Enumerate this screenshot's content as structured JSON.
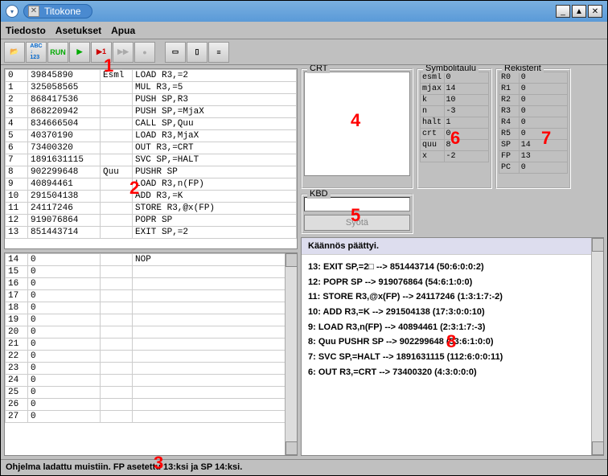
{
  "window": {
    "title": "Titokone"
  },
  "menu": {
    "file": "Tiedosto",
    "settings": "Asetukset",
    "help": "Apua"
  },
  "toolbar": {
    "open": "📂",
    "abc123": "ABC\n123",
    "run": "RUN",
    "step": "▶",
    "step1": "▶1",
    "ff": "▶▶",
    "stop": "●",
    "v1": "▭",
    "v2": "▯",
    "v3": "≡"
  },
  "marks": {
    "m1": "1",
    "m2": "2",
    "m3": "3",
    "m4": "4",
    "m5": "5",
    "m6": "6",
    "m7": "7",
    "m8": "8"
  },
  "table1": [
    [
      "0",
      "39845890",
      "Esml",
      "LOAD R3,=2"
    ],
    [
      "1",
      "325058565",
      "",
      "MUL  R3,=5"
    ],
    [
      "2",
      "868417536",
      "",
      "PUSH SP,R3"
    ],
    [
      "3",
      "868220942",
      "",
      "PUSH SP,=MjaX"
    ],
    [
      "4",
      "834666504",
      "",
      "CALL SP,Quu"
    ],
    [
      "5",
      "40370190",
      "",
      "LOAD R3,MjaX"
    ],
    [
      "6",
      "73400320",
      "",
      "OUT  R3,=CRT"
    ],
    [
      "7",
      "1891631115",
      "",
      "SVC  SP,=HALT"
    ],
    [
      "8",
      "902299648",
      "Quu",
      "PUSHR SP"
    ],
    [
      "9",
      "40894461",
      "",
      "LOAD  R3,n(FP)"
    ],
    [
      "10",
      "291504138",
      "",
      "ADD   R3,=K"
    ],
    [
      "11",
      "24117246",
      "",
      "STORE R3,@x(FP)"
    ],
    [
      "12",
      "919076864",
      "",
      "POPR  SP"
    ],
    [
      "13",
      "851443714",
      "",
      "EXIT  SP,=2"
    ]
  ],
  "table2": [
    [
      "14",
      "0",
      "",
      "NOP"
    ],
    [
      "15",
      "0",
      "",
      ""
    ],
    [
      "16",
      "0",
      "",
      ""
    ],
    [
      "17",
      "0",
      "",
      ""
    ],
    [
      "18",
      "0",
      "",
      ""
    ],
    [
      "19",
      "0",
      "",
      ""
    ],
    [
      "20",
      "0",
      "",
      ""
    ],
    [
      "21",
      "0",
      "",
      ""
    ],
    [
      "22",
      "0",
      "",
      ""
    ],
    [
      "23",
      "0",
      "",
      ""
    ],
    [
      "24",
      "0",
      "",
      ""
    ],
    [
      "25",
      "0",
      "",
      ""
    ],
    [
      "26",
      "0",
      "",
      ""
    ],
    [
      "27",
      "0",
      "",
      ""
    ]
  ],
  "crt": {
    "title": "CRT"
  },
  "kbd": {
    "title": "KBD",
    "btn": "Syötä"
  },
  "sym": {
    "title": "Symbolitaulu",
    "rows": [
      [
        "esml",
        "0"
      ],
      [
        "mjax",
        "14"
      ],
      [
        "k",
        "10"
      ],
      [
        "n",
        "-3"
      ],
      [
        "halt",
        "1"
      ],
      [
        "crt",
        "0"
      ],
      [
        "quu",
        "8"
      ],
      [
        "x",
        "-2"
      ]
    ]
  },
  "reg": {
    "title": "Rekisterit",
    "rows": [
      [
        "R0",
        "0"
      ],
      [
        "R1",
        "0"
      ],
      [
        "R2",
        "0"
      ],
      [
        "R3",
        "0"
      ],
      [
        "R4",
        "0"
      ],
      [
        "R5",
        "0"
      ],
      [
        "SP",
        "14"
      ],
      [
        "FP",
        "13"
      ],
      [
        "PC",
        "0"
      ]
    ]
  },
  "log": {
    "head": "Käännös päättyi.",
    "lines": [
      "13:      EXIT  SP,=2□ --> 851443714 (50:6:0:0:2)",
      "12:      POPR  SP --> 919076864 (54:6:1:0:0)",
      "11:      STORE R3,@x(FP) --> 24117246 (1:3:1:7:-2)",
      "10:      ADD   R3,=K --> 291504138 (17:3:0:0:10)",
      "9:     LOAD  R3,n(FP) --> 40894461 (2:3:1:7:-3)",
      "8: Quu    PUSHR SP --> 902299648 (53:6:1:0:0)",
      "7:      SVC   SP,=HALT --> 1891631115 (112:6:0:0:11)",
      "6:      OUT  R3,=CRT --> 73400320 (4:3:0:0:0)"
    ]
  },
  "status": "Ohjelma ladattu muistiin. FP asetettu 13:ksi ja SP 14:ksi."
}
